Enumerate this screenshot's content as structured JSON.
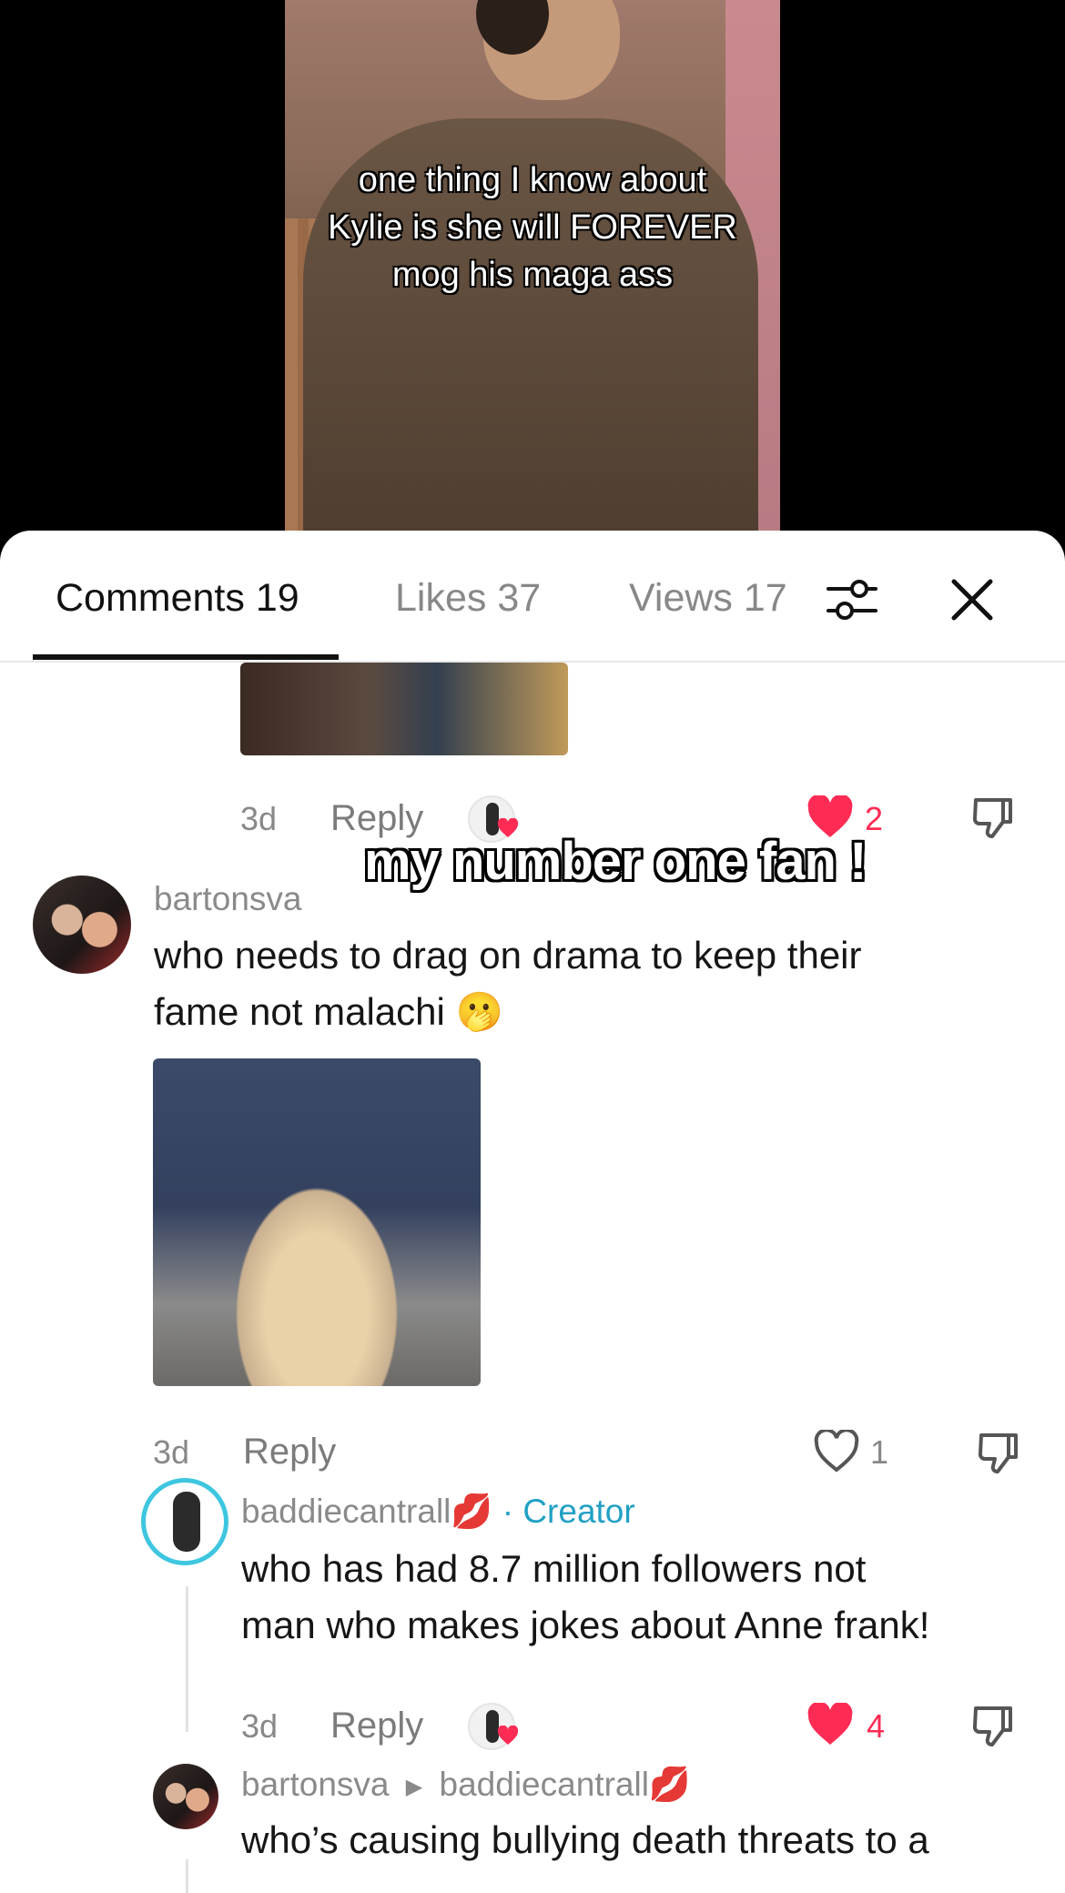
{
  "video": {
    "caption_lines": [
      "one thing I know about",
      "Kylie is she will FOREVER",
      "mog his maga ass"
    ]
  },
  "tabs": {
    "comments": "Comments 19",
    "likes": "Likes 37",
    "views": "Views 17"
  },
  "icons": {
    "filter": "sliders-icon",
    "close": "close-icon",
    "like": "heart-icon",
    "dislike": "thumbs-down-icon"
  },
  "colors": {
    "heart_red": "#fe2c55",
    "creator_blue": "#21a0c4"
  },
  "comment0": {
    "time": "3d",
    "reply": "Reply",
    "likes": "2"
  },
  "sticker_text": "my number one fan !",
  "comment1": {
    "username": "bartonsva",
    "text_line1": "who needs to drag on drama to keep their",
    "text_line2": "fame not malachi 🫢",
    "time": "3d",
    "reply": "Reply",
    "likes": "1"
  },
  "reply1": {
    "username": "baddiecantrall💋",
    "creator_label": " · Creator",
    "text_line1": "who has had 8.7 million followers not",
    "text_line2": "man who makes jokes about Anne frank!",
    "time": "3d",
    "reply": "Reply",
    "likes": "4"
  },
  "reply2": {
    "username": "bartonsva",
    "reply_to": "baddiecantrall💋",
    "text_line1": "who’s causing bullying death threats to a"
  }
}
